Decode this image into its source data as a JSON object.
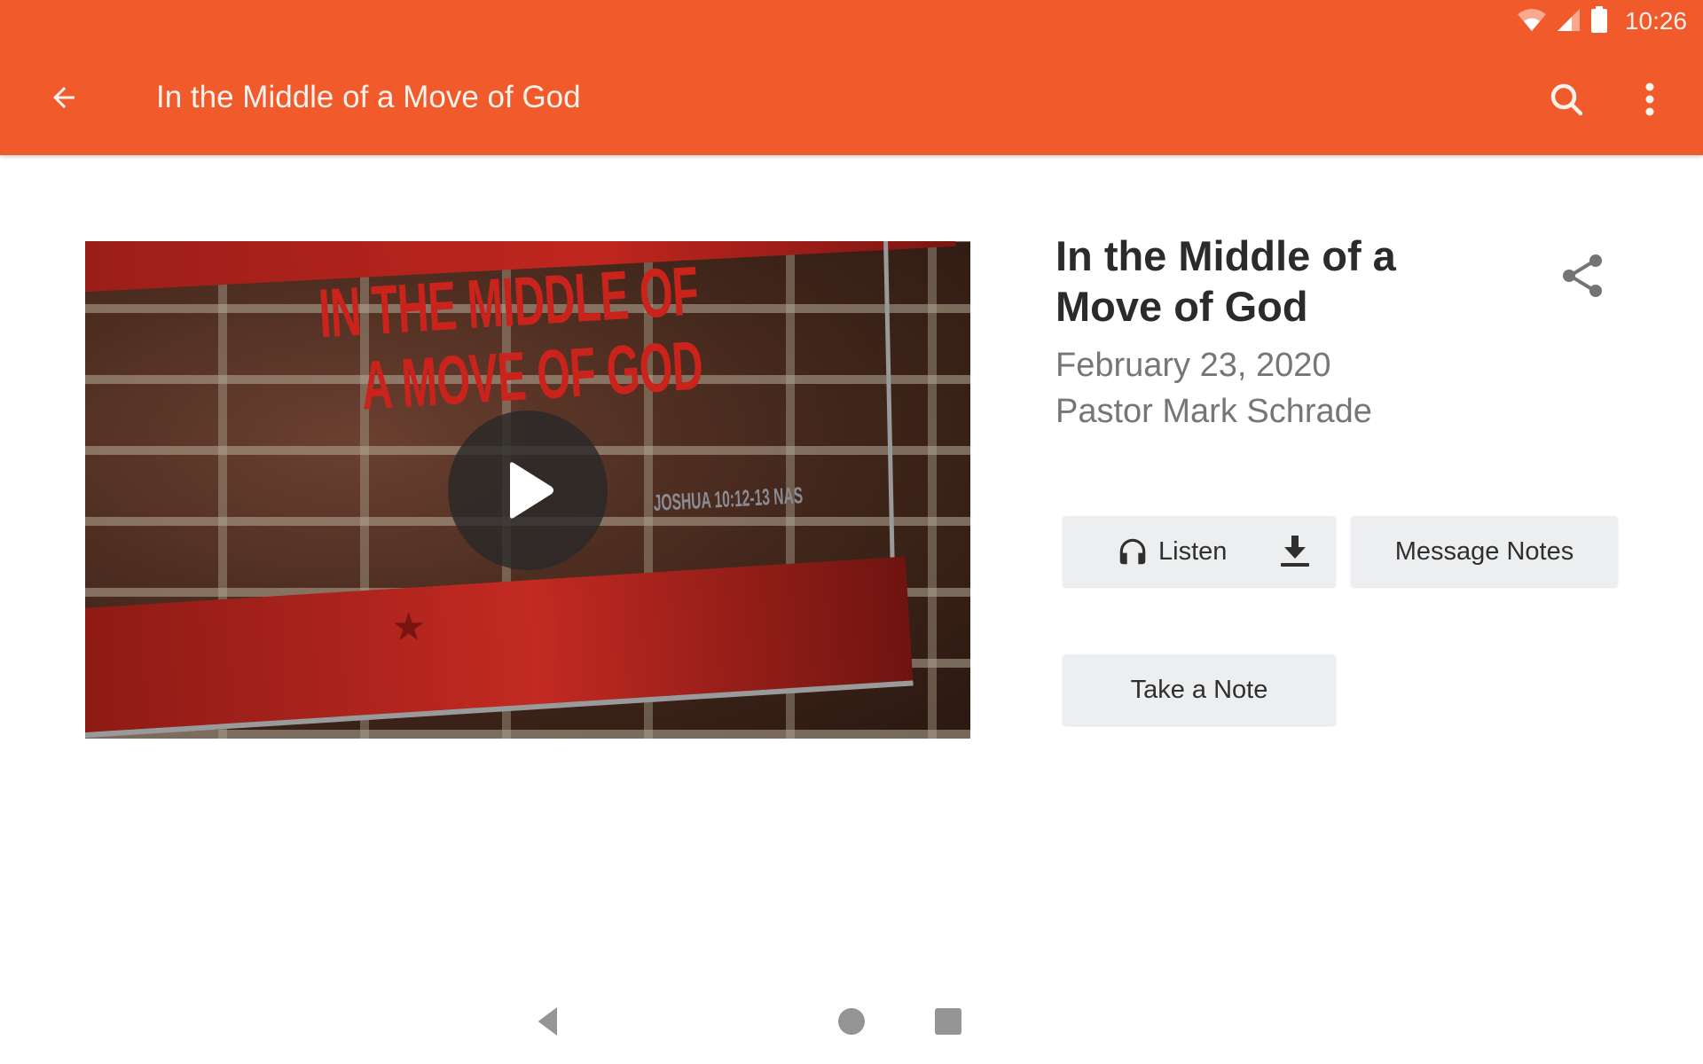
{
  "status_bar": {
    "time": "10:26",
    "icons": [
      "wifi-icon",
      "cell-signal-icon",
      "battery-icon"
    ]
  },
  "app_bar": {
    "title": "In the Middle of a Move of God",
    "back_icon": "arrow-left-icon",
    "search_icon": "search-icon",
    "more_icon": "more-vert-icon",
    "color": "#f15a2b"
  },
  "media": {
    "thumbnail": {
      "slide_title": "IN THE MIDDLE OF A MOVE OF GOD",
      "slide_reference": "JOSHUA 10:12-13 NAS"
    },
    "play_icon": "play-icon"
  },
  "details": {
    "title": "In the Middle of a Move of God",
    "date": "February 23, 2020",
    "speaker": "Pastor Mark Schrade",
    "share_icon": "share-icon"
  },
  "actions": {
    "listen_label": "Listen",
    "listen_icon": "headphones-icon",
    "download_icon": "download-icon",
    "message_notes_label": "Message Notes",
    "take_note_label": "Take a Note"
  },
  "nav_bar": {
    "items": [
      "back",
      "home",
      "recents"
    ]
  }
}
